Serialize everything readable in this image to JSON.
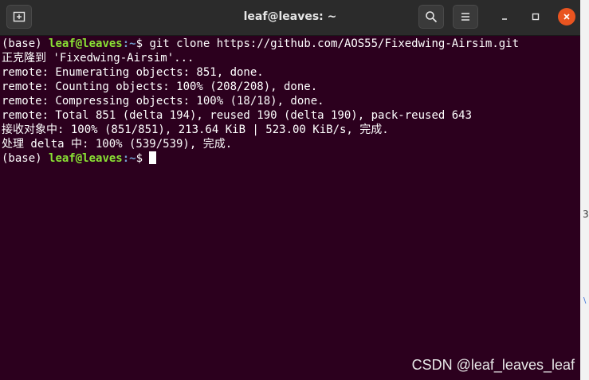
{
  "window": {
    "title": "leaf@leaves: ~",
    "new_tab_icon": "new-tab-icon",
    "search_icon": "search-icon",
    "menu_icon": "hamburger-menu-icon",
    "close_color": "#e95420"
  },
  "terminal": {
    "background": "#2c001e",
    "prompt_user_color": "#8ae234",
    "prompt_path_color": "#729fcf",
    "prompt1": {
      "env": "(base) ",
      "user": "leaf@leaves",
      "path": ":~",
      "symbol": "$ ",
      "command": "git clone https://github.com/AOS55/Fixedwing-Airsim.git"
    },
    "output": [
      "正克隆到 'Fixedwing-Airsim'...",
      "remote: Enumerating objects: 851, done.",
      "remote: Counting objects: 100% (208/208), done.",
      "remote: Compressing objects: 100% (18/18), done.",
      "remote: Total 851 (delta 194), reused 190 (delta 190), pack-reused 643",
      "接收对象中: 100% (851/851), 213.64 KiB | 523.00 KiB/s, 完成.",
      "处理 delta 中: 100% (539/539), 完成."
    ],
    "prompt2": {
      "env": "(base) ",
      "user": "leaf@leaves",
      "path": ":~",
      "symbol": "$ "
    }
  },
  "watermark": "CSDN @leaf_leaves_leaf",
  "background_strip": {
    "glyph1": "3",
    "glyph2": "\\"
  }
}
